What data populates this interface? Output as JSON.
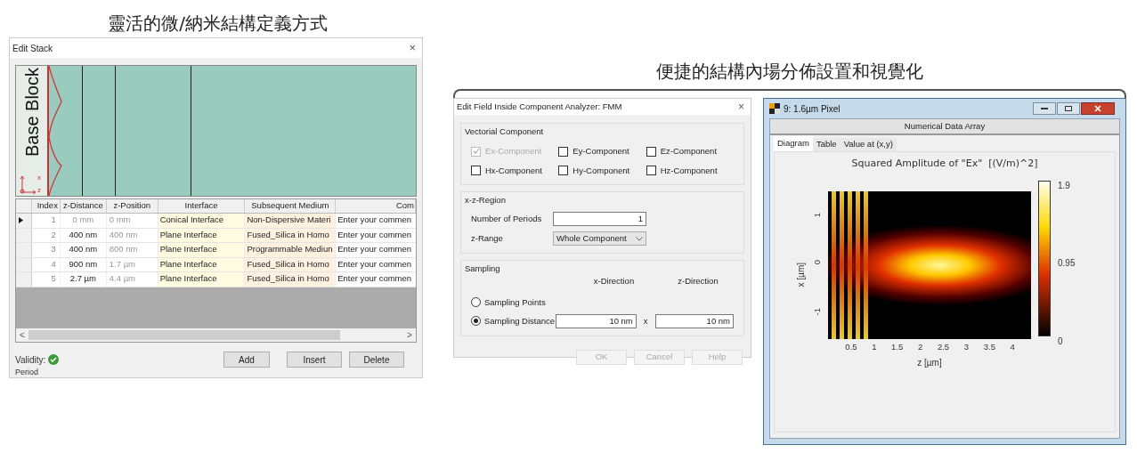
{
  "left_caption": "靈活的微/納米結構定義方式",
  "right_caption": "便捷的結構內場分佈設置和視覺化",
  "edit_stack": {
    "title": "Edit Stack",
    "close": "×",
    "base_block": "Base Block",
    "axis_x": "x",
    "axis_z": "z",
    "columns": [
      "Index",
      "z-Distance",
      "z-Position",
      "Interface",
      "Subsequent Medium",
      "Com"
    ],
    "rows": [
      {
        "selected": true,
        "index": "1",
        "z_distance": "0 mm",
        "z_distance_disabled": true,
        "z_position": "0 mm",
        "interface": "Conical Interface",
        "medium": "Non-Dispersive Materi",
        "comment": "Enter your commen"
      },
      {
        "selected": false,
        "index": "2",
        "z_distance": "400 nm",
        "z_distance_disabled": false,
        "z_position": "400 nm",
        "interface": "Plane Interface",
        "medium": "Fused_Silica in Homo",
        "comment": "Enter your commen"
      },
      {
        "selected": false,
        "index": "3",
        "z_distance": "400 nm",
        "z_distance_disabled": false,
        "z_position": "800 nm",
        "interface": "Plane Interface",
        "medium": "Programmable Mediun",
        "comment": "Enter your commen"
      },
      {
        "selected": false,
        "index": "4",
        "z_distance": "900 nm",
        "z_distance_disabled": false,
        "z_position": "1.7 µm",
        "interface": "Plane Interface",
        "medium": "Fused_Silica in Homo",
        "comment": "Enter your commen"
      },
      {
        "selected": false,
        "index": "5",
        "z_distance": "2.7 µm",
        "z_distance_disabled": false,
        "z_position": "4.4 µm",
        "interface": "Plane Interface",
        "medium": "Fused_Silica in Homo",
        "comment": "Enter your commen"
      }
    ],
    "scroll_left": "<",
    "scroll_right": ">",
    "validity_label": "Validity:",
    "buttons": [
      "Add",
      "Insert",
      "Delete"
    ],
    "period_label": "Period"
  },
  "field_dialog": {
    "title": "Edit Field Inside Component Analyzer: FMM",
    "close": "×",
    "vectorial": {
      "label": "Vectorial Component",
      "components": [
        {
          "label": "Ex-Component",
          "checked": true,
          "disabled": true
        },
        {
          "label": "Ey-Component",
          "checked": false,
          "disabled": false
        },
        {
          "label": "Ez-Component",
          "checked": false,
          "disabled": false
        },
        {
          "label": "Hx-Component",
          "checked": false,
          "disabled": false
        },
        {
          "label": "Hy-Component",
          "checked": false,
          "disabled": false
        },
        {
          "label": "Hz-Component",
          "checked": false,
          "disabled": false
        }
      ]
    },
    "region": {
      "label": "x-z-Region",
      "periods_label": "Number of Periods",
      "periods_value": "1",
      "range_label": "z-Range",
      "range_value": "Whole Component"
    },
    "sampling": {
      "label": "Sampling",
      "x_header": "x-Direction",
      "z_header": "z-Direction",
      "options": [
        {
          "label": "Sampling Points",
          "selected": false
        },
        {
          "label": "Sampling Distance",
          "selected": true
        }
      ],
      "x_value": "10 nm",
      "times": "x",
      "z_value": "10 nm"
    },
    "buttons": [
      {
        "label": "OK",
        "disabled": true
      },
      {
        "label": "Cancel",
        "disabled": true
      },
      {
        "label": "Help",
        "disabled": true
      }
    ]
  },
  "result_window": {
    "title": "9: 1.6µm Pixel",
    "subtitle": "Numerical Data Array",
    "tabs": [
      {
        "label": "Diagram",
        "selected": true
      },
      {
        "label": "Table",
        "selected": false
      },
      {
        "label": "Value at (x,y)",
        "selected": false
      }
    ],
    "plot_title": "Squared Amplitude of \"Ex\"  [(V/m)^2]",
    "ylabel": "x [µm]",
    "xlabel": "z [µm]",
    "yticks": [
      "1",
      "0",
      "-1"
    ],
    "xticks": [
      "0.5",
      "1",
      "1.5",
      "2",
      "2.5",
      "3",
      "3.5",
      "4"
    ],
    "colorbar_labels": [
      "1.9",
      "0.95",
      "0"
    ]
  }
}
